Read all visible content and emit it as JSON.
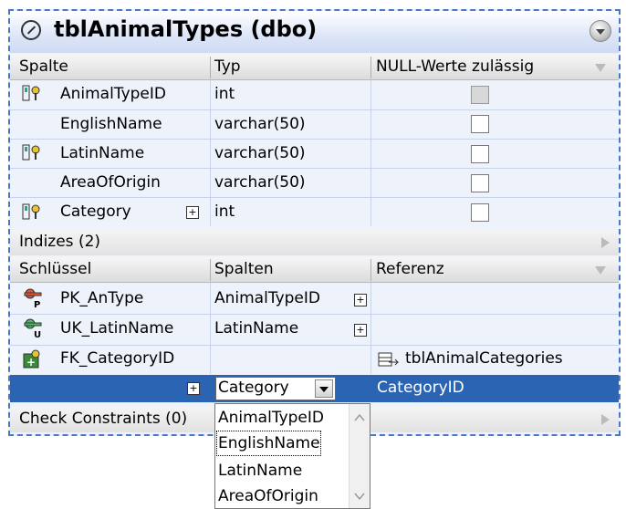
{
  "title": "tblAnimalTypes (dbo)",
  "columns_header": {
    "col1": "Spalte",
    "col2": "Typ",
    "col3": "NULL-Werte zulässig"
  },
  "columns": [
    {
      "name": "AnimalTypeID",
      "type": "int",
      "key": true,
      "nullable": false,
      "nullable_disabled": true
    },
    {
      "name": "EnglishName",
      "type": "varchar(50)",
      "key": false,
      "nullable": false
    },
    {
      "name": "LatinName",
      "type": "varchar(50)",
      "key": true,
      "nullable": false
    },
    {
      "name": "AreaOfOrigin",
      "type": "varchar(50)",
      "key": false,
      "nullable": false
    },
    {
      "name": "Category",
      "type": "int",
      "key": true,
      "nullable": false
    }
  ],
  "indexes_label": "Indizes (2)",
  "keys_header": {
    "col1": "Schlüssel",
    "col2": "Spalten",
    "col3": "Referenz"
  },
  "keys": [
    {
      "name": "PK_AnType",
      "columns": "AnimalTypeID",
      "reference": "",
      "icon": "primary-key-icon"
    },
    {
      "name": "UK_LatinName",
      "columns": "LatinName",
      "reference": "",
      "icon": "unique-key-icon"
    },
    {
      "name": "FK_CategoryID",
      "columns": "",
      "reference": "tblAnimalCategories",
      "icon": "foreign-key-icon"
    }
  ],
  "selected_row": {
    "column_value": "Category",
    "reference_column": "CategoryID"
  },
  "check_constraints_label": "Check Constraints (0)",
  "dropdown_options": [
    "AnimalTypeID",
    "EnglishName",
    "LatinName",
    "AreaOfOrigin"
  ],
  "colors": {
    "selection": "#2c64b4",
    "frame": "#4a78c8"
  }
}
